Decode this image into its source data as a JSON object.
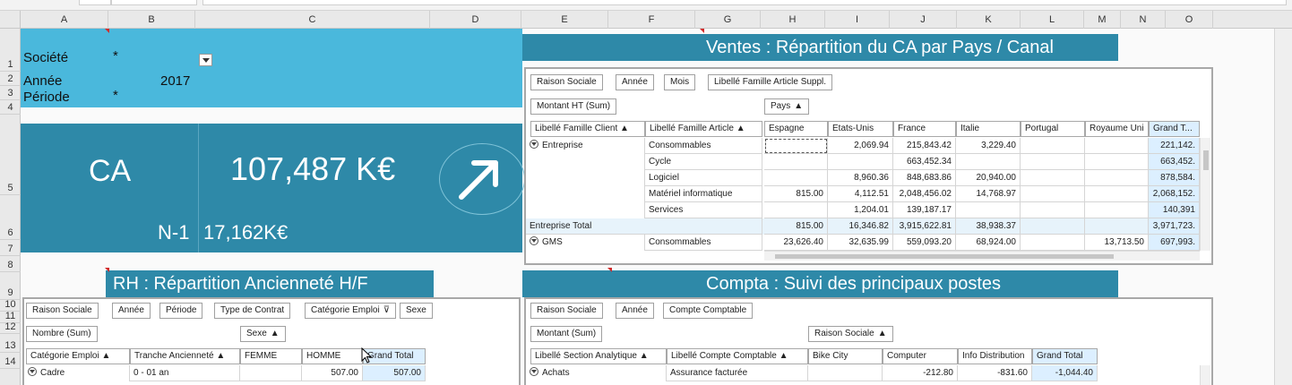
{
  "columns": [
    "A",
    "B",
    "C",
    "D",
    "E",
    "F",
    "G",
    "H",
    "I",
    "J",
    "K",
    "L",
    "M",
    "N",
    "O"
  ],
  "rows": [
    "1",
    "2",
    "3",
    "4",
    "5",
    "6",
    "7",
    "8",
    "9",
    "10",
    "11",
    "12",
    "13",
    "14"
  ],
  "filters": {
    "societe_label": "Société",
    "societe_value": "*",
    "annee_label": "Année",
    "annee_value": "2017",
    "periode_label": "Période",
    "periode_value": "*"
  },
  "kpi": {
    "label": "CA",
    "value": "107,487 K€",
    "n1_label": "N-1",
    "n1_value": "17,162K€",
    "trend_icon": "arrow-up-right-icon"
  },
  "ventes": {
    "title": "Ventes : Répartition du CA par Pays / Canal",
    "filter_chips": [
      "Raison Sociale",
      "Année",
      "Mois",
      "Libellé Famille Article Suppl."
    ],
    "value_chip": "Montant HT (Sum)",
    "column_field": "Pays",
    "row_fields": [
      "Libellé Famille Client",
      "Libellé Famille Article"
    ],
    "col_headers": [
      "Espagne",
      "Etats-Unis",
      "France",
      "Italie",
      "Portugal",
      "Royaume Uni",
      "Grand T..."
    ],
    "rows": [
      {
        "group": "Entreprise",
        "item": "Consommables",
        "vals": [
          "",
          "2,069.94",
          "215,843.42",
          "3,229.40",
          "",
          "",
          "221,142."
        ]
      },
      {
        "group": "",
        "item": "Cycle",
        "vals": [
          "",
          "",
          "663,452.34",
          "",
          "",
          "",
          "663,452."
        ]
      },
      {
        "group": "",
        "item": "Logiciel",
        "vals": [
          "",
          "8,960.36",
          "848,683.86",
          "20,940.00",
          "",
          "",
          "878,584."
        ]
      },
      {
        "group": "",
        "item": "Matériel informatique",
        "vals": [
          "815.00",
          "4,112.51",
          "2,048,456.02",
          "14,768.97",
          "",
          "",
          "2,068,152."
        ]
      },
      {
        "group": "",
        "item": "Services",
        "vals": [
          "",
          "1,204.01",
          "139,187.17",
          "",
          "",
          "",
          "140,391"
        ]
      }
    ],
    "total_row": {
      "label": "Entreprise Total",
      "vals": [
        "815.00",
        "16,346.82",
        "3,915,622.81",
        "38,938.37",
        "",
        "",
        "3,971,723."
      ]
    },
    "gms_row": {
      "group": "GMS",
      "item": "Consommables",
      "vals": [
        "23,626.40",
        "32,635.99",
        "559,093.20",
        "68,924.00",
        "",
        "13,713.50",
        "697,993."
      ]
    }
  },
  "rh": {
    "title": "RH : Répartition Ancienneté H/F",
    "filter_chips": [
      "Raison Sociale",
      "Année",
      "Période",
      "Type de Contrat",
      "Catégorie Emploi",
      "Sexe"
    ],
    "value_chip": "Nombre (Sum)",
    "column_field": "Sexe",
    "row_fields": [
      "Catégorie Emploi",
      "Tranche Ancienneté"
    ],
    "col_headers": [
      "FEMME",
      "HOMME",
      "Grand Total"
    ],
    "rows": [
      {
        "group": "Cadre",
        "item": "0 - 01 an",
        "vals": [
          "",
          "507.00",
          "507.00"
        ]
      }
    ]
  },
  "compta": {
    "title": "Compta : Suivi des principaux postes",
    "filter_chips": [
      "Raison Sociale",
      "Année",
      "Compte Comptable"
    ],
    "value_chip": "Montant (Sum)",
    "column_field": "Raison Sociale",
    "row_fields": [
      "Libellé Section Analytique",
      "Libellé Compte Comptable"
    ],
    "col_headers": [
      "Bike City",
      "Computer",
      "Info Distribution",
      "Grand Total"
    ],
    "rows": [
      {
        "group": "Achats",
        "item": "Assurance facturée",
        "vals": [
          "",
          "-212.80",
          "-831.60",
          "-1,044.40"
        ]
      }
    ]
  },
  "colors": {
    "light_blue": "#4ab8dc",
    "dark_teal": "#2e89a8",
    "grand_total_bg": "#dcefff"
  }
}
